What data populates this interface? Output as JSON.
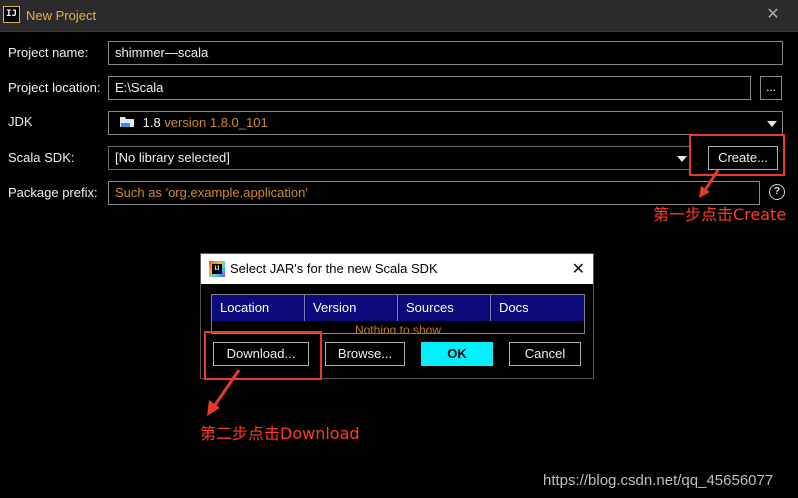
{
  "window": {
    "icon_text": "IJ",
    "title": "New Project",
    "close_glyph": "✕"
  },
  "form": {
    "project_name": {
      "label": "Project name:",
      "value": "shimmer—scala"
    },
    "project_location": {
      "label": "Project location:",
      "value": "E:\\Scala",
      "browse_label": "..."
    },
    "jdk": {
      "label": "JDK",
      "value_main": "1.8",
      "value_version": "version 1.8.0_101"
    },
    "scala_sdk": {
      "label": "Scala SDK:",
      "value": "[No library selected]",
      "create_label": "Create..."
    },
    "package_prefix": {
      "label": "Package prefix:",
      "placeholder": "Such as 'org.example.application'",
      "help_glyph": "?"
    }
  },
  "annotations": {
    "step1": "第一步点击Create",
    "step2": "第二步点击Download"
  },
  "dialog": {
    "title": "Select JAR's for the new Scala SDK",
    "close_glyph": "✕",
    "columns": [
      "Location",
      "Version",
      "Sources",
      "Docs"
    ],
    "empty_text": "Nothing to show",
    "buttons": {
      "download": "Download...",
      "browse": "Browse...",
      "ok": "OK",
      "cancel": "Cancel"
    }
  },
  "watermark": "https://blog.csdn.net/qq_45656077",
  "colors": {
    "title_accent": "#e0b050",
    "placeholder": "#d08a2a",
    "annotation_red": "#ff3b2b",
    "table_header": "#0a0a7a",
    "ok_button": "#00f0ff"
  }
}
